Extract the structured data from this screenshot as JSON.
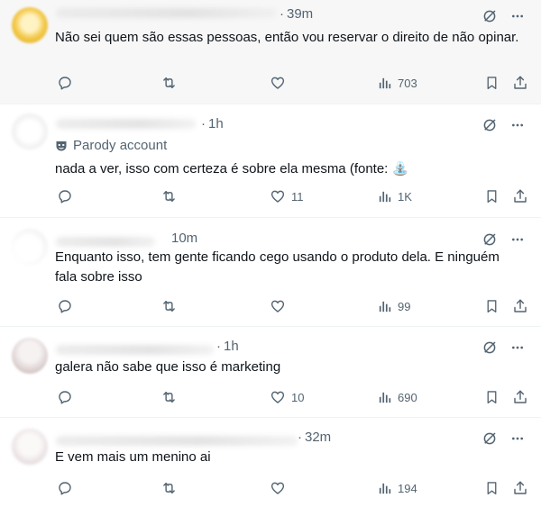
{
  "posts": [
    {
      "time": "39m",
      "text": "Não sei quem são essas pessoas, então vou reservar o direito de não opinar.",
      "replies": "",
      "reposts": "",
      "likes": "",
      "views": "703"
    },
    {
      "time": "1h",
      "badge": "Parody account",
      "text": "nada a ver, isso com certeza é sobre ela mesma (fonte: ⛲",
      "replies": "",
      "reposts": "",
      "likes": "11",
      "views": "1K"
    },
    {
      "time": "10m",
      "text": "Enquanto isso, tem gente ficando cego usando o produto dela. E ninguém fala sobre isso",
      "replies": "",
      "reposts": "",
      "likes": "",
      "views": "99"
    },
    {
      "time": "1h",
      "text": "galera não sabe que isso é marketing",
      "replies": "",
      "reposts": "",
      "likes": "10",
      "views": "690"
    },
    {
      "time": "32m",
      "text": "E vem mais um menino ai",
      "replies": "",
      "reposts": "",
      "likes": "",
      "views": "194"
    }
  ],
  "icons": {
    "grok": "grok-icon",
    "more": "more-icon",
    "reply": "reply-icon",
    "repost": "repost-icon",
    "like": "like-icon",
    "views": "views-icon",
    "bookmark": "bookmark-icon",
    "share": "share-icon"
  },
  "colors": {
    "secondary_text": "#536471",
    "primary_text": "#0f1419",
    "divider": "#eff3f4"
  }
}
